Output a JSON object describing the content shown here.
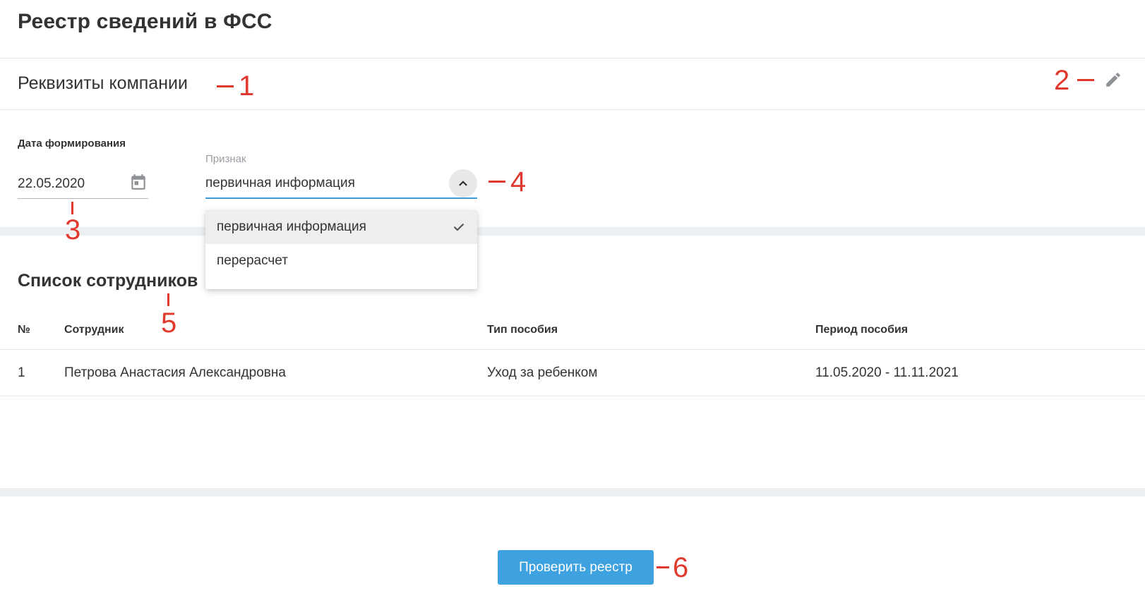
{
  "page": {
    "title": "Реестр сведений в ФСС"
  },
  "company_section": {
    "title": "Реквизиты компании",
    "edit_icon": "pencil-icon"
  },
  "form": {
    "date_label": "Дата формирования",
    "date_value": "22.05.2020",
    "calendar_icon": "calendar-icon",
    "sign_label": "Признак",
    "sign_value": "первичная информация",
    "toggle_icon": "chevron-up-icon",
    "options": [
      {
        "label": "первичная информация",
        "selected": true
      },
      {
        "label": "перерасчет",
        "selected": false
      }
    ]
  },
  "employees": {
    "title": "Список сотрудников",
    "columns": [
      "№",
      "Сотрудник",
      "Тип пособия",
      "Период пособия"
    ],
    "rows": [
      {
        "num": "1",
        "name": "Петрова Анастасия Александровна",
        "benefit_type": "Уход за ребенком",
        "period": "11.05.2020 - 11.11.2021"
      }
    ]
  },
  "actions": {
    "check_label": "Проверить реестр"
  },
  "annotations": [
    "1",
    "2",
    "3",
    "4",
    "5",
    "6"
  ],
  "colors": {
    "accent": "#3ea1e0",
    "annotation": "#e03a2e",
    "divider": "#e4e6ea",
    "band": "#edf0f3"
  }
}
